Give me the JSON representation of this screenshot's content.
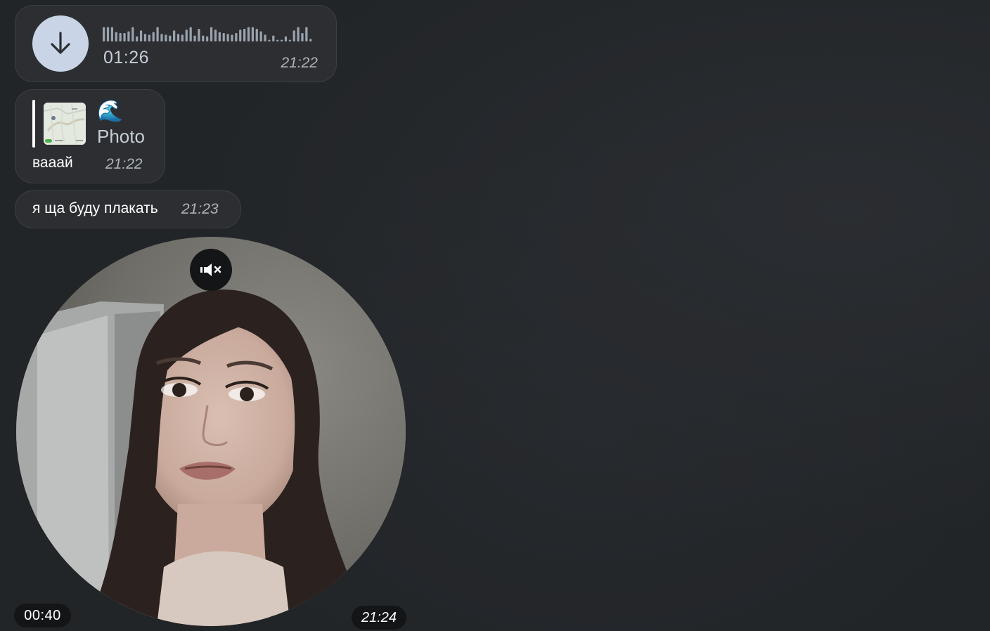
{
  "messages": {
    "voice": {
      "duration": "01:26",
      "time": "21:22",
      "download_icon": "arrow-down-icon",
      "waveform": [
        0.85,
        0.85,
        0.85,
        0.55,
        0.5,
        0.5,
        0.6,
        0.85,
        0.3,
        0.65,
        0.45,
        0.4,
        0.55,
        0.85,
        0.45,
        0.4,
        0.35,
        0.65,
        0.45,
        0.4,
        0.7,
        0.85,
        0.35,
        0.75,
        0.35,
        0.3,
        0.85,
        0.7,
        0.55,
        0.5,
        0.45,
        0.4,
        0.5,
        0.7,
        0.75,
        0.85,
        0.85,
        0.75,
        0.6,
        0.4,
        0.1,
        0.35,
        0.1,
        0.1,
        0.3,
        0.1,
        0.65,
        0.85,
        0.5,
        0.85,
        0.15
      ]
    },
    "reply": {
      "quote_emoji": "🌊",
      "quote_label": "Photo",
      "text": "вааай",
      "time": "21:22"
    },
    "text": {
      "text": "я ща буду плакать",
      "time": "21:23"
    },
    "round_video": {
      "duration": "00:40",
      "time": "21:24",
      "mute_icon": "speaker-muted-icon"
    }
  },
  "colors": {
    "background": "#222528",
    "bubble": "#2c2e31",
    "download_button": "#c9d5e6",
    "waveform": "#9aa3ad"
  }
}
